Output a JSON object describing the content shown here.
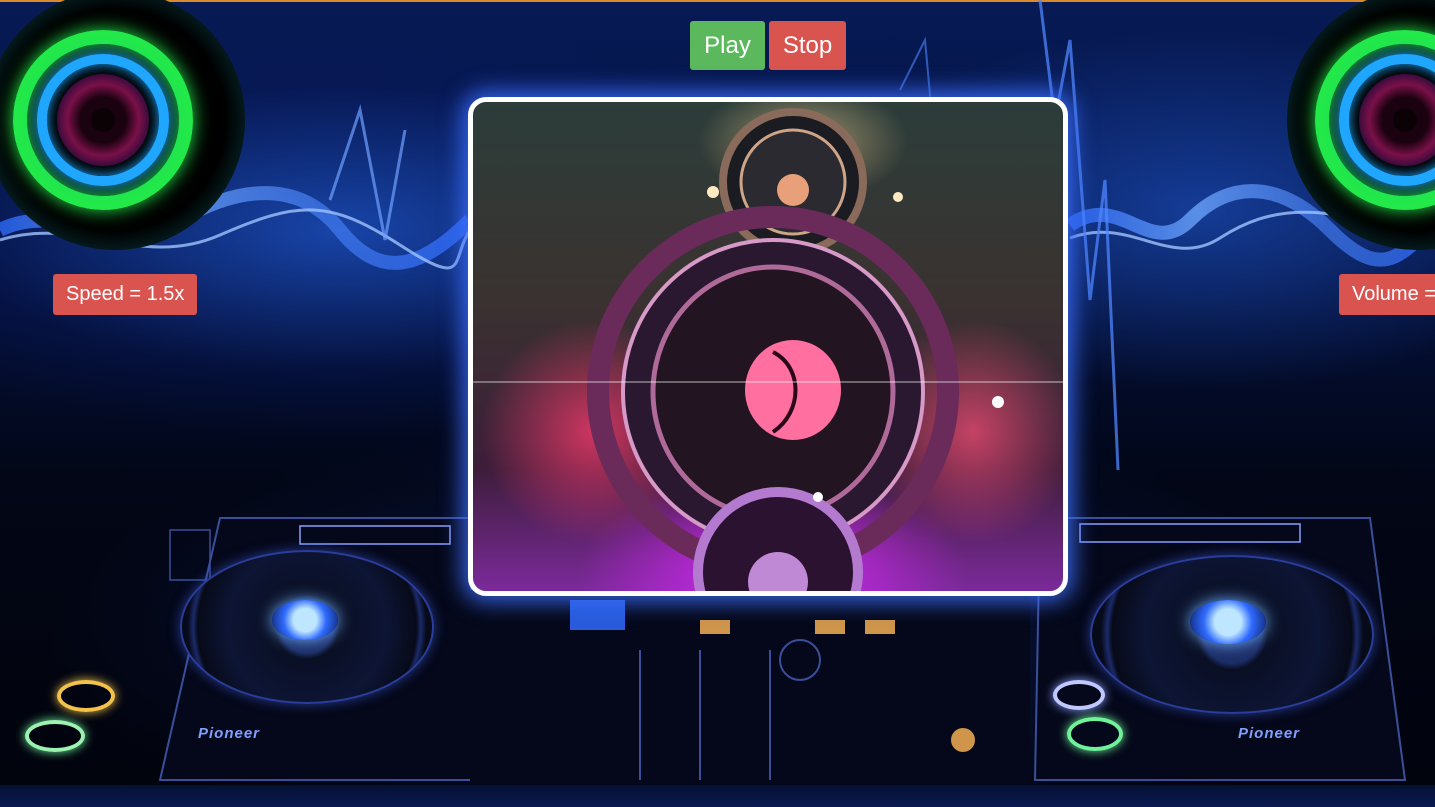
{
  "controls": {
    "play_label": "Play",
    "stop_label": "Stop"
  },
  "status": {
    "speed_text": "Speed = 1.5x",
    "volume_text": "Volume = "
  },
  "decks": {
    "left_brand": "Pioneer",
    "right_brand": "Pioneer"
  },
  "colors": {
    "play_button": "#5cb85c",
    "stop_button": "#d9534f",
    "badge": "#d9534f",
    "frame_border": "#ffffff",
    "frame_glow": "#3c6eff",
    "speaker_ring_outer": "#22e84a",
    "speaker_ring_mid": "#1fa6ff"
  },
  "icons": {
    "left_visual": "speaker-visualizer-icon",
    "right_visual": "speaker-visualizer-icon",
    "video_content": "glowing-speaker-video"
  }
}
